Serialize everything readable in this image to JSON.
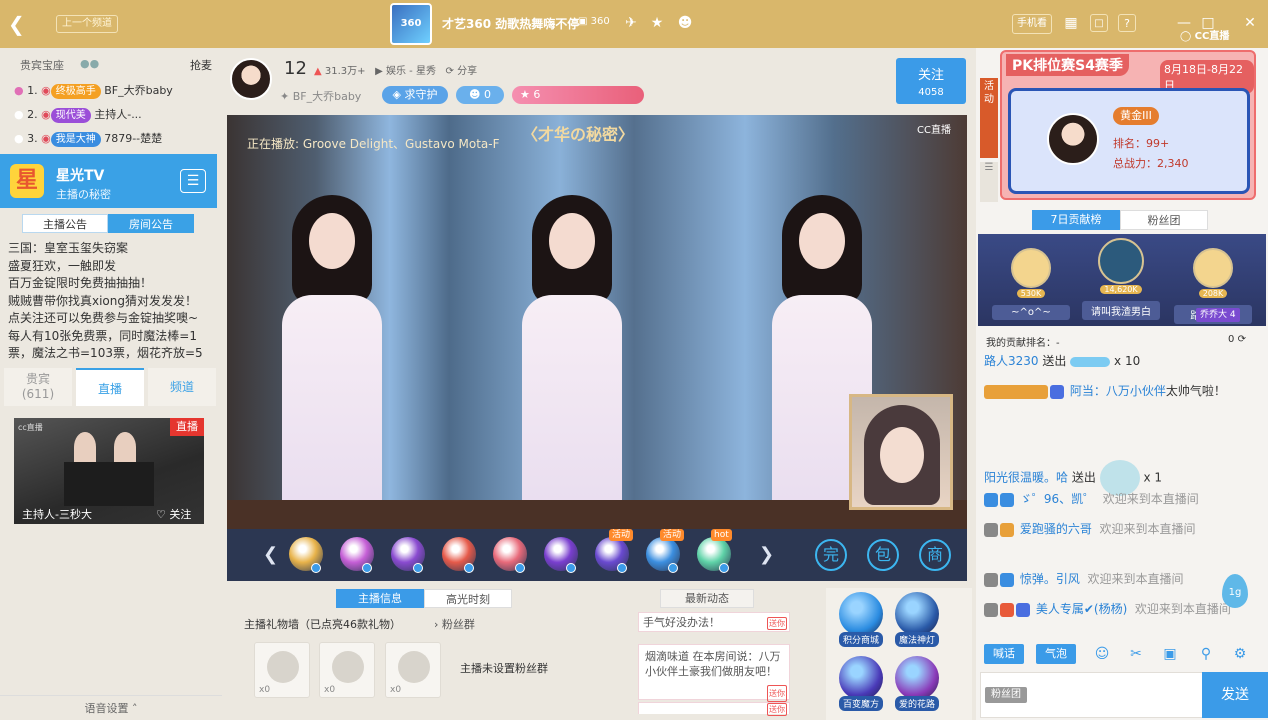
{
  "topbar": {
    "prev_label": "上一个频道",
    "room_logo_text": "360",
    "room_title": "才艺360  劲歌热舞嗨不停",
    "room_number": "360",
    "btn_phone": "手机看",
    "colors": {
      "bar": "#d9b76b",
      "accent": "#3b9be8"
    }
  },
  "left": {
    "seat_label": "贵宾宝座",
    "grab_label": "抢麦",
    "ranks": [
      {
        "no": "1.",
        "badge": "终极高手",
        "badge_color": "#f4a023",
        "name": "BF_大乔baby"
      },
      {
        "no": "2.",
        "badge": "现代美",
        "badge_color": "#9b4fd8",
        "name": "主持人-..."
      },
      {
        "no": "3.",
        "badge": "我是大神",
        "badge_color": "#3a8de0",
        "name": "7879--楚楚"
      }
    ],
    "channel_name": "星光TV",
    "channel_sub": "主播の秘密",
    "tabs": [
      "主播公告",
      "房间公告"
    ],
    "notice_lines": [
      "三国：皇室玉玺失窃案",
      "盛夏狂欢，一触即发",
      "百万金锭限时免费抽抽抽！",
      "贼贼曹带你找真xiong猜对发发发！",
      "点关注还可以免费参与金锭抽奖噢~",
      "每人有10张免费票，同时魔法棒=1",
      "票，魔法之书=103票，烟花齐放=5"
    ],
    "bottom_tabs": [
      {
        "label": "贵宾",
        "sub": "(611)"
      },
      {
        "label": "直播",
        "sub": ""
      },
      {
        "label": "频道",
        "sub": ""
      }
    ],
    "thumb": {
      "live_label": "直播",
      "host": "主持人-三秒大",
      "follow": "关注",
      "logo": "cc直播"
    },
    "voice_settings": "语音设置"
  },
  "center": {
    "anchor_num": "12",
    "popularity": "31.3万+",
    "category": "娱乐 - 星秀",
    "share": "分享",
    "anchor_name": "BF_大乔baby",
    "guard_label": "求守护",
    "fans_count": "0",
    "level": "6",
    "follow_label": "关注",
    "follow_count": "4058",
    "video": {
      "now_playing": "正在播放: Groove Delight、Gustavo Mota-F",
      "show_title": "〈才华の秘密〉",
      "cc_logo": "CC直播"
    },
    "gifts": [
      {
        "color": "#e8b34a",
        "tag": ""
      },
      {
        "color": "#c55fd6",
        "tag": ""
      },
      {
        "color": "#8a4bd0",
        "tag": ""
      },
      {
        "color": "#e65a4a",
        "tag": ""
      },
      {
        "color": "#e86a7a",
        "tag": ""
      },
      {
        "color": "#7a3fcf",
        "tag": ""
      },
      {
        "color": "#6a4ad0",
        "tag": "活动"
      },
      {
        "color": "#3c8fe0",
        "tag": "活动"
      },
      {
        "color": "#5fd3a8",
        "tag": "hot"
      }
    ],
    "gift_icons": [
      "完",
      "包",
      "商"
    ],
    "low_tabs": [
      "主播信息",
      "高光时刻"
    ],
    "gift_wall": "主播礼物墙（已点亮46款礼物）",
    "fan_group": "粉丝群",
    "gift_slots": [
      "x0",
      "x0",
      "x0"
    ],
    "no_fan_group": "主播未设置粉丝群",
    "news_tab": "最新动态",
    "news": [
      {
        "text": "手气好没办法！",
        "tag": "送你"
      },
      {
        "text": "烟滴味道  在本房间说：八万小伙伴土豪我们做朋友吧！",
        "tag": "送你"
      }
    ],
    "right_icons": [
      {
        "label": "积分商城",
        "color": "#2a8be0"
      },
      {
        "label": "魔法神灯",
        "color": "#2a5aa8"
      },
      {
        "label": "百变魔方",
        "color": "#4a3ab8"
      },
      {
        "label": "爱的花路",
        "color": "#8a3ab8"
      }
    ]
  },
  "right": {
    "activity_label": "活动",
    "pk_title": "PK排位赛S4赛季",
    "pk_dates": "8月18日-8月22日",
    "pk_rank": "黄金III",
    "pk_rank_line": "排名：99+",
    "pk_power_line": "总战力：2,340",
    "tabs": [
      "7日贡献榜",
      "粉丝团"
    ],
    "podium": [
      {
        "score": "530K",
        "name": "~^o^~"
      },
      {
        "score": "14,620K",
        "name": "请叫我渣男白"
      },
      {
        "score": "208K",
        "name": "路人7496",
        "tag": "乔乔大",
        "tag_num": "4"
      }
    ],
    "my_rank_label": "我的贡献排名：-",
    "my_rank_value": "0",
    "chat": [
      {
        "user": "路人3230",
        "text": "送出",
        "extra": "x 10"
      },
      {
        "user": "阿当：八万小伙伴",
        "text": "太帅气啦！"
      },
      {
        "user": "阳光很温暖。哈",
        "text": "送出",
        "extra": "x 1"
      },
      {
        "user": "ゞ゜96、凯゜",
        "text": "欢迎来到本直播间"
      },
      {
        "user": "爱跑骚的六哥",
        "text": "欢迎来到本直播间"
      },
      {
        "user": "惊弹。引风",
        "text": "欢迎来到本直播间"
      },
      {
        "user": "美人专属✔(杨杨)",
        "text": "欢迎来到本直播间"
      }
    ],
    "tools": [
      "喊话",
      "气泡"
    ],
    "fan_badge": "粉丝团",
    "send_label": "发送",
    "drop_label": "1g"
  }
}
